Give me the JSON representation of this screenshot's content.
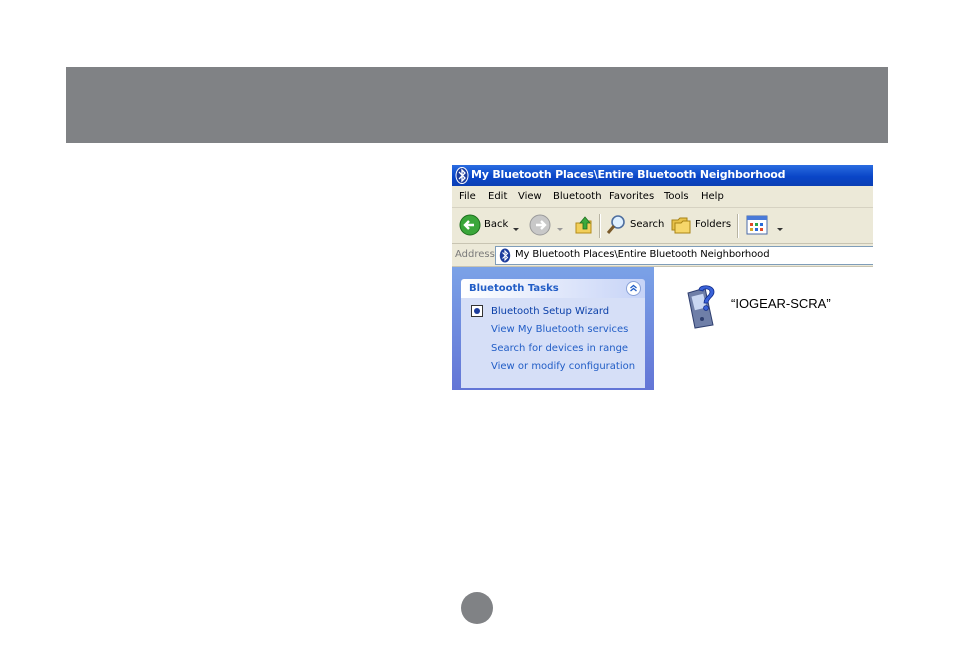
{
  "window": {
    "title": "My Bluetooth Places\\Entire Bluetooth Neighborhood",
    "menu": [
      "File",
      "Edit",
      "View",
      "Bluetooth",
      "Favorites",
      "Tools",
      "Help"
    ],
    "toolbar": {
      "back_label": "Back",
      "search_label": "Search",
      "folders_label": "Folders"
    },
    "address": {
      "label": "Address",
      "value": "My Bluetooth Places\\Entire Bluetooth Neighborhood"
    },
    "tasks": {
      "header": "Bluetooth Tasks",
      "items": [
        "Bluetooth Setup Wizard",
        "View My Bluetooth services",
        "Search for devices in range",
        "View or modify configuration"
      ]
    },
    "device": {
      "name": "“IOGEAR-SCRA”",
      "icon": "unknown-device-icon"
    }
  },
  "colors": {
    "page_band": "#808285",
    "titlebar": "#0a46c8",
    "task_link": "#215dc6",
    "task_pane": "#7ba2e7"
  }
}
